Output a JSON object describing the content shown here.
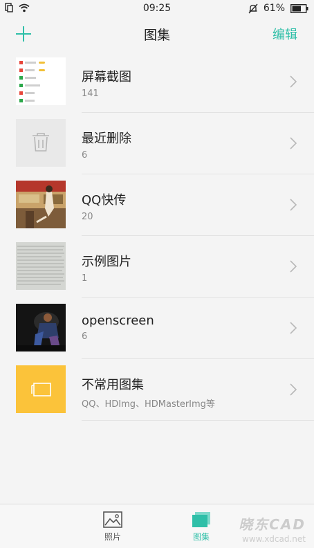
{
  "status_bar": {
    "time": "09:25",
    "battery_percent": "61%",
    "icons": [
      "sim-card-icon",
      "wifi-icon",
      "bell-muted-icon",
      "battery-icon"
    ]
  },
  "header": {
    "title": "图集",
    "edit_label": "编辑",
    "add_icon": "plus-icon"
  },
  "albums": [
    {
      "name": "屏幕截图",
      "count": "141",
      "thumb": "screenshot-thumb"
    },
    {
      "name": "最近删除",
      "count": "6",
      "thumb": "trash-icon"
    },
    {
      "name": "QQ快传",
      "count": "20",
      "thumb": "photo-thumb"
    },
    {
      "name": "示例图片",
      "count": "1",
      "thumb": "photo-thumb"
    },
    {
      "name": "openscreen",
      "count": "6",
      "thumb": "photo-thumb"
    },
    {
      "name": "不常用图集",
      "count": "QQ、HDImg、HDMasterImg等",
      "thumb": "folder-icon"
    }
  ],
  "bottom_nav": {
    "tabs": [
      {
        "label": "照片",
        "icon": "photo-icon",
        "active": false
      },
      {
        "label": "图集",
        "icon": "album-icon",
        "active": true
      }
    ]
  },
  "watermark": {
    "top": "晓东CAD",
    "bottom": "www.xdcad.net"
  },
  "colors": {
    "accent": "#2fbfa8",
    "background": "#f4f4f4",
    "folder_yellow": "#fbc33a"
  }
}
